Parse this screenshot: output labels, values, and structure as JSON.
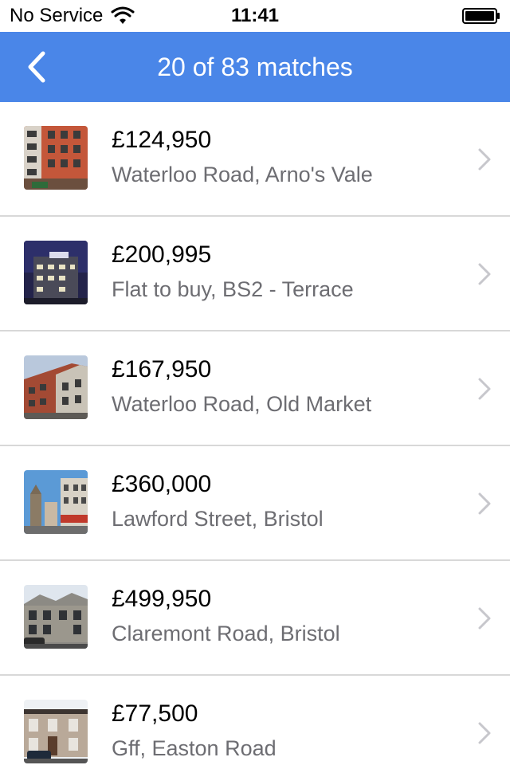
{
  "status_bar": {
    "carrier": "No Service",
    "time": "11:41",
    "wifi_icon": "wifi-icon",
    "battery_icon": "battery-icon"
  },
  "nav": {
    "back_icon": "chevron-left-icon",
    "title": "20 of 83 matches",
    "bar_color": "#4a86e8"
  },
  "listings": [
    {
      "price": "£124,950",
      "address": "Waterloo Road, Arno's Vale"
    },
    {
      "price": "£200,995",
      "address": "Flat to buy, BS2 - Terrace"
    },
    {
      "price": "£167,950",
      "address": "Waterloo Road, Old Market"
    },
    {
      "price": "£360,000",
      "address": "Lawford Street, Bristol"
    },
    {
      "price": "£499,950",
      "address": "Claremont Road, Bristol"
    },
    {
      "price": "£77,500",
      "address": "Gff, Easton Road"
    }
  ]
}
